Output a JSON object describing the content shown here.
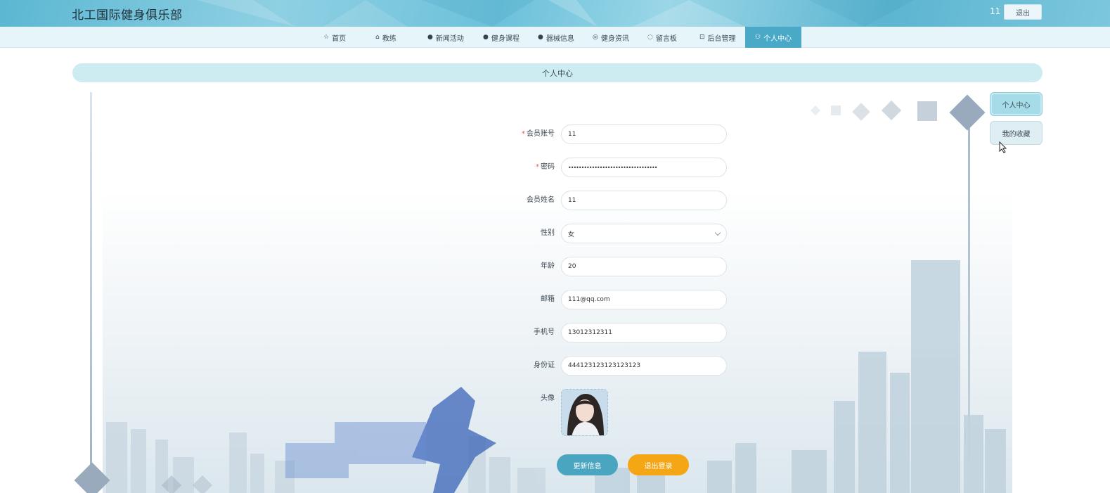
{
  "header": {
    "site_title": "北工国际健身俱乐部",
    "username": "11",
    "logout_label": "退出"
  },
  "nav": {
    "items": [
      {
        "label": "首页",
        "icon": "star-icon"
      },
      {
        "label": "教练",
        "icon": "bag-icon"
      },
      {
        "label": "新闻活动",
        "icon": "info-icon"
      },
      {
        "label": "健身课程",
        "icon": "help-icon"
      },
      {
        "label": "器械信息",
        "icon": "info-icon"
      },
      {
        "label": "健身资讯",
        "icon": "globe-icon"
      },
      {
        "label": "留言板",
        "icon": "chat-icon"
      },
      {
        "label": "后台管理",
        "icon": "box-icon"
      },
      {
        "label": "个人中心",
        "icon": "user-icon",
        "active": true
      }
    ]
  },
  "banner": {
    "title": "个人中心"
  },
  "side_menu": {
    "personal_center": "个人中心",
    "my_favorites": "我的收藏"
  },
  "form": {
    "account": {
      "label": "会员账号",
      "required": true,
      "value": "11"
    },
    "password": {
      "label": "密码",
      "required": true,
      "value": "••••••••••••••••••••••••••••••••••"
    },
    "name": {
      "label": "会员姓名",
      "value": "11"
    },
    "gender": {
      "label": "性别",
      "value": "女"
    },
    "age": {
      "label": "年龄",
      "value": "20"
    },
    "email": {
      "label": "邮箱",
      "value": "111@qq.com"
    },
    "phone": {
      "label": "手机号",
      "value": "13012312311"
    },
    "id_card": {
      "label": "身份证",
      "value": "444123123123123123"
    },
    "avatar": {
      "label": "头像"
    }
  },
  "actions": {
    "update_label": "更新信息",
    "logout_label": "退出登录"
  },
  "colors": {
    "accent": "#4aa9c6",
    "logout_button": "#f5a614",
    "banner": "#cdecf1"
  }
}
